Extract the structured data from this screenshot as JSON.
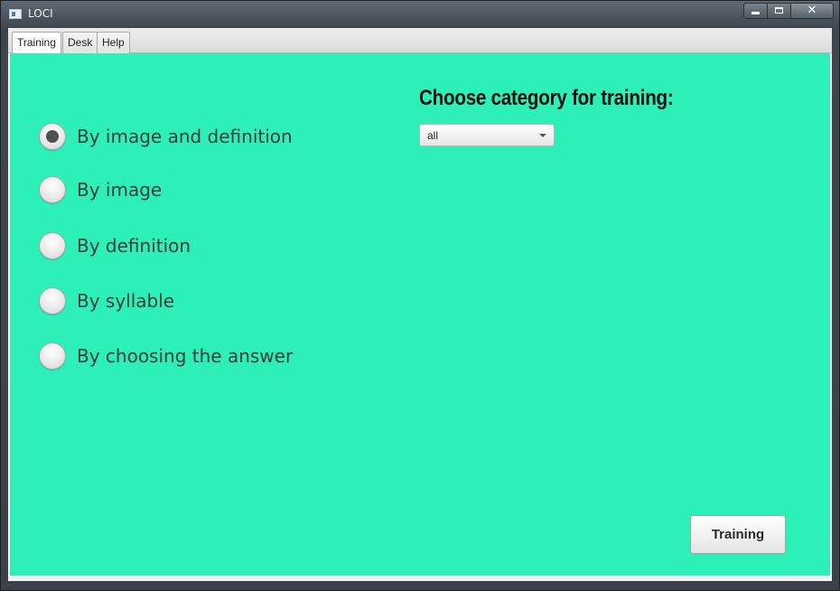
{
  "window": {
    "title": "LOCI",
    "minimize_glyph": "minimize-icon",
    "maximize_glyph": "maximize-icon",
    "close_glyph": "✕"
  },
  "tabs": [
    {
      "label": "Training",
      "selected": true
    },
    {
      "label": "Desk",
      "selected": false
    },
    {
      "label": "Help",
      "selected": false
    }
  ],
  "training_modes": [
    {
      "label": "By image and definition",
      "checked": true
    },
    {
      "label": "By image",
      "checked": false
    },
    {
      "label": "By definition",
      "checked": false
    },
    {
      "label": "By syllable",
      "checked": false
    },
    {
      "label": "By choosing the answer",
      "checked": false
    }
  ],
  "category": {
    "heading": "Choose category for training:",
    "selected": "all"
  },
  "actions": {
    "training_label": "Training"
  },
  "colors": {
    "content_background": "#2cf0b8",
    "radio_checked_dot": "#505050"
  }
}
